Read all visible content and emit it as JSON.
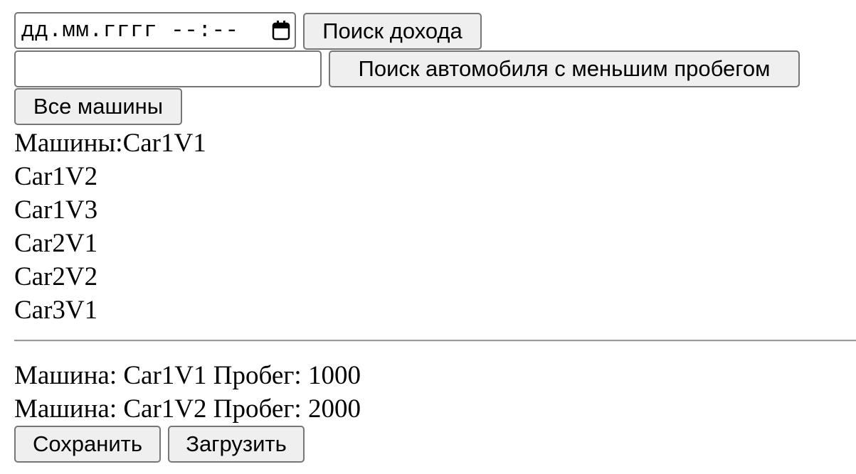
{
  "date_search": {
    "placeholder": "дд.мм.гггг --:--",
    "button_label": "Поиск дохода"
  },
  "mileage_search": {
    "value": "",
    "button_label": "Поиск автомобиля с меньшим пробегом"
  },
  "all_cars_button_label": "Все машины",
  "cars_list": {
    "prefix": "Машины:",
    "items": [
      "Car1V1",
      "Car1V2",
      "Car1V3",
      "Car2V1",
      "Car2V2",
      "Car3V1"
    ]
  },
  "mileage_results": [
    {
      "car_label": "Машина:",
      "car": "Car1V1",
      "mileage_label": "Пробег:",
      "mileage": "1000"
    },
    {
      "car_label": "Машина:",
      "car": "Car1V2",
      "mileage_label": "Пробег:",
      "mileage": "2000"
    }
  ],
  "actions": {
    "save_label": "Сохранить",
    "load_label": "Загрузить"
  }
}
